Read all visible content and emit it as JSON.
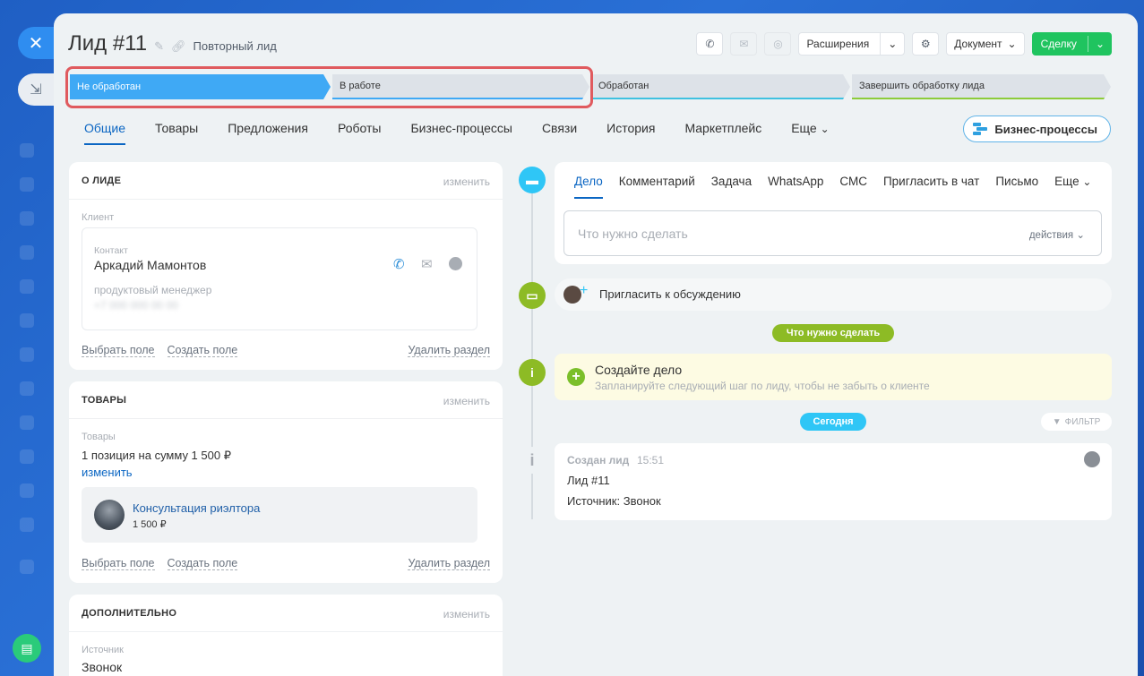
{
  "rail": {
    "close_glyph": "✕",
    "collapse_glyph": "⇲"
  },
  "header": {
    "title": "Лид #11",
    "subtitle": "Повторный лид"
  },
  "toolbar": {
    "extensions_label": "Расширения",
    "document_label": "Документ",
    "deal_label": "Сделку"
  },
  "stages": [
    {
      "label": "Не обработан",
      "active": true
    },
    {
      "label": "В работе",
      "active": false
    },
    {
      "label": "Обработан",
      "active": false
    },
    {
      "label": "Завершить обработку лида",
      "active": false
    }
  ],
  "tabs": [
    "Общие",
    "Товары",
    "Предложения",
    "Роботы",
    "Бизнес-процессы",
    "Связи",
    "История",
    "Маркетплейс",
    "Еще"
  ],
  "bp_button_label": "Бизнес-процессы",
  "about": {
    "title": "О ЛИДЕ",
    "edit": "изменить",
    "client_label": "Клиент",
    "contact_label": "Контакт",
    "contact_name": "Аркадий Мамонтов",
    "contact_position": "продуктовый менеджер",
    "contact_phone": "+7 000 000 00 00",
    "select_field": "Выбрать поле",
    "create_field": "Создать поле",
    "delete_section": "Удалить раздел"
  },
  "products": {
    "title": "ТОВАРЫ",
    "edit": "изменить",
    "label": "Товары",
    "summary": "1 позиция на сумму 1 500 ₽",
    "change_link": "изменить",
    "item_name": "Консультация риэлтора",
    "item_price": "1 500 ₽",
    "select_field": "Выбрать поле",
    "create_field": "Создать поле",
    "delete_section": "Удалить раздел"
  },
  "extra": {
    "title": "ДОПОЛНИТЕЛЬНО",
    "edit": "изменить",
    "source_label": "Источник",
    "source_value": "Звонок"
  },
  "editor": {
    "tabs": [
      "Дело",
      "Комментарий",
      "Задача",
      "WhatsApp",
      "СМС",
      "Пригласить в чат",
      "Письмо",
      "Еще"
    ],
    "placeholder": "Что нужно сделать",
    "actions": "действия"
  },
  "timeline": {
    "invite_label": "Пригласить к обсуждению",
    "todo_pill": "Что нужно сделать",
    "create_title": "Создайте дело",
    "create_hint": "Запланируйте следующий шаг по лиду, чтобы не забыть о клиенте",
    "today_pill": "Сегодня",
    "filter_label": "ФИЛЬТР",
    "event_title": "Создан лид",
    "event_time": "15:51",
    "event_line1": "Лид #11",
    "event_line2": "Источник: Звонок"
  }
}
